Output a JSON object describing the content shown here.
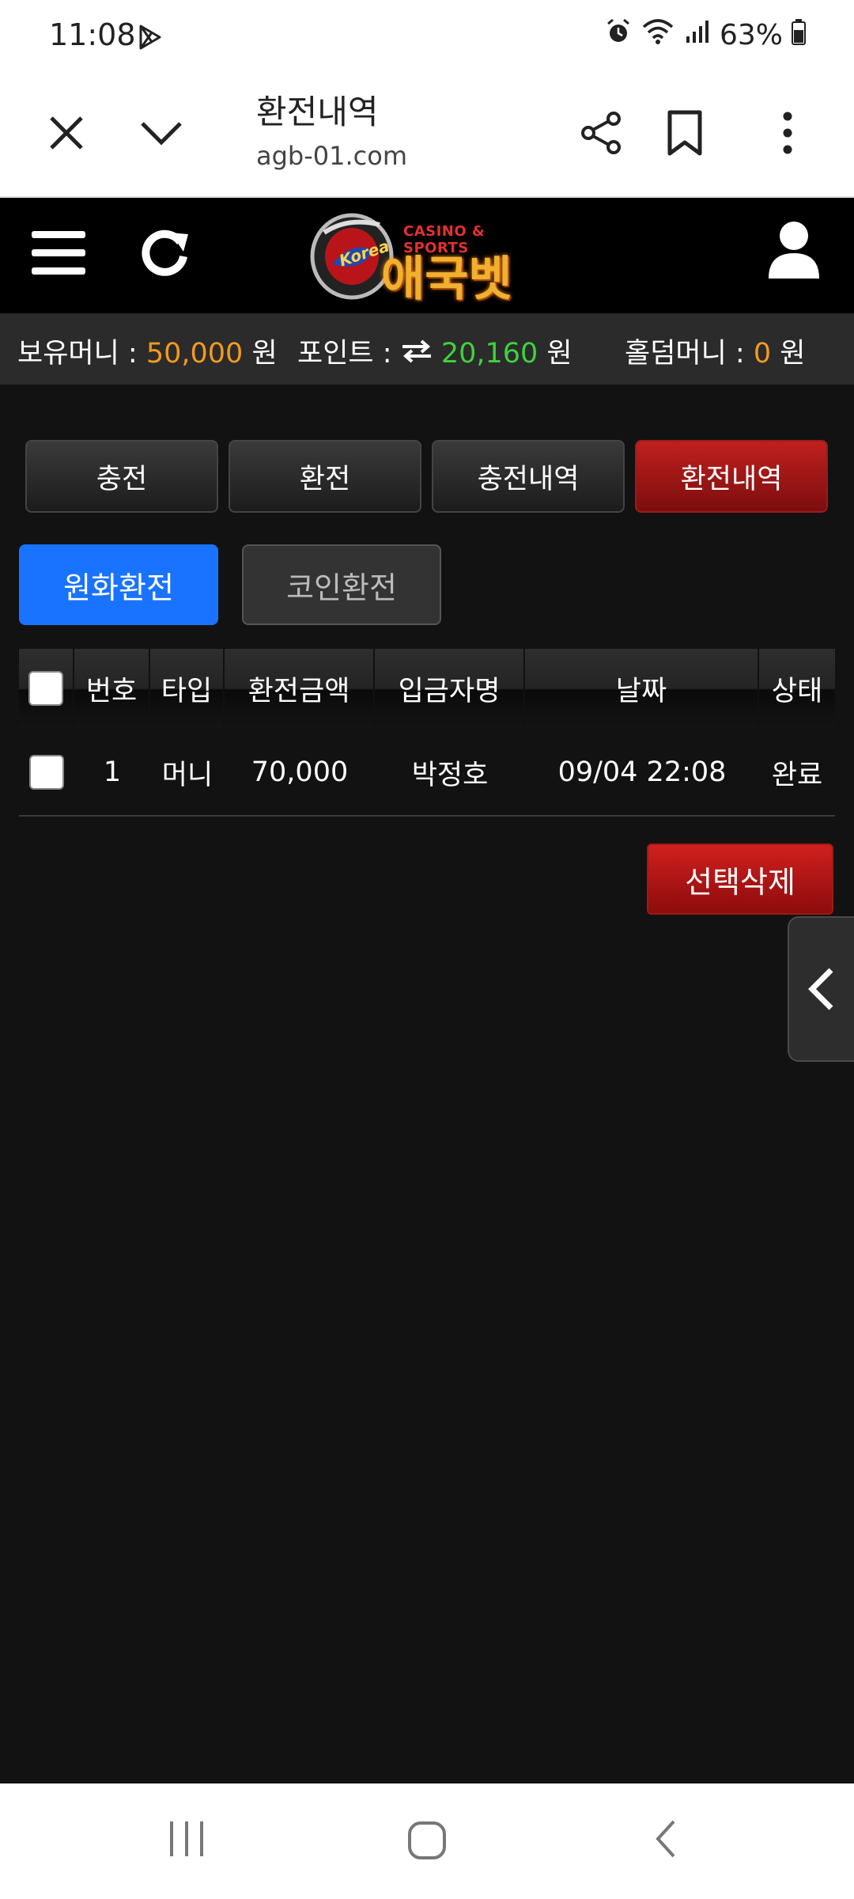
{
  "status": {
    "time": "11:08",
    "battery": "63%"
  },
  "browser": {
    "title": "환전내역",
    "url": "agb-01.com"
  },
  "site": {
    "logo_tag": "CASINO & SPORTS",
    "logo_name": "애국벳",
    "logo_emblem_text": "Korea"
  },
  "balance": {
    "money_label": "보유머니 :",
    "money_value": "50,000",
    "money_unit": "원",
    "point_label": "포인트 :",
    "point_value": "20,160",
    "point_unit": "원",
    "holdem_label": "홀덤머니 :",
    "holdem_value": "0",
    "holdem_unit": "원"
  },
  "tabs": [
    {
      "label": "충전",
      "active": false
    },
    {
      "label": "환전",
      "active": false
    },
    {
      "label": "충전내역",
      "active": false
    },
    {
      "label": "환전내역",
      "active": true
    }
  ],
  "subtabs": [
    {
      "label": "원화환전",
      "active": true
    },
    {
      "label": "코인환전",
      "active": false
    }
  ],
  "table": {
    "headers": [
      "번호",
      "타입",
      "환전금액",
      "입금자명",
      "날짜",
      "상태"
    ],
    "rows": [
      {
        "no": "1",
        "type": "머니",
        "amount": "70,000",
        "name": "박정호",
        "date": "09/04 22:08",
        "status": "완료"
      }
    ]
  },
  "delete_button": "선택삭제",
  "colors": {
    "accent_red": "#c0201e",
    "accent_blue": "#1a73ff",
    "money_orange": "#f39a1e",
    "point_green": "#3ed23e"
  }
}
